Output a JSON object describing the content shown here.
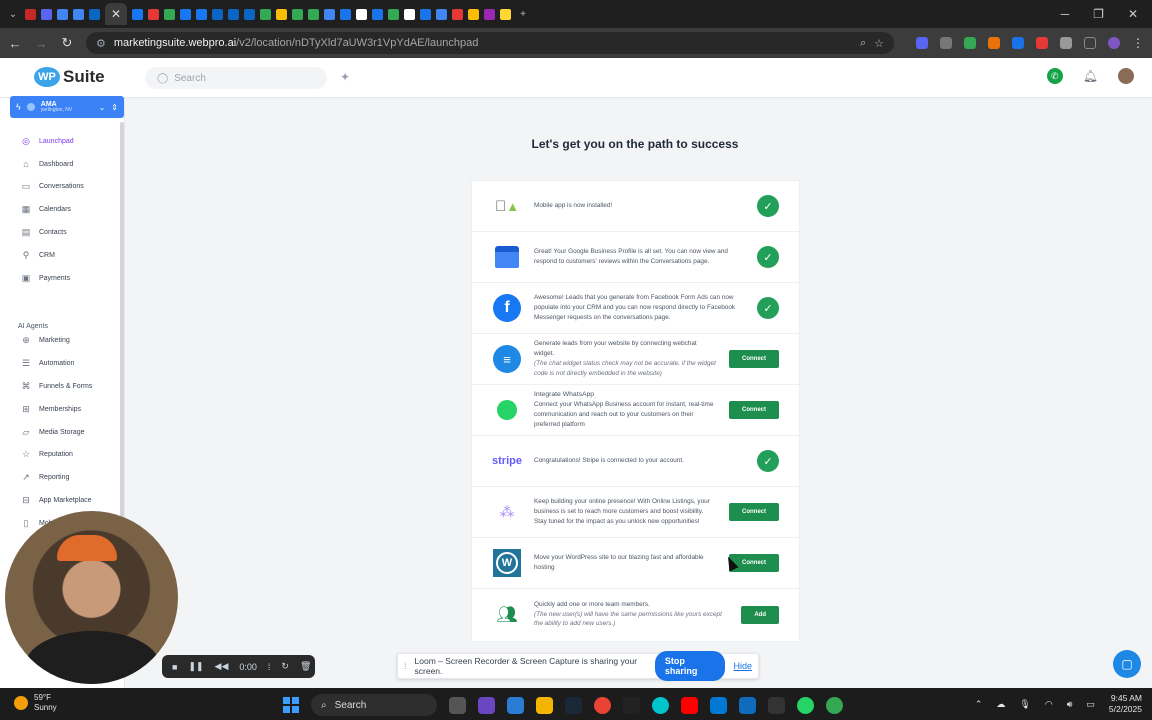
{
  "browser": {
    "url_host": "marketingsuite.webpro.ai",
    "url_path": "/v2/location/nDTyXld7aUW3r1VpYdAE/launchpad"
  },
  "header": {
    "logo_badge": "WP",
    "logo_text": "Suite",
    "search_placeholder": "Search"
  },
  "account": {
    "name": "AMA",
    "location": "yerlington, NV"
  },
  "sidebar": {
    "items": [
      {
        "label": "Launchpad",
        "icon": "rocket-icon",
        "active": true
      },
      {
        "label": "Dashboard",
        "icon": "home-icon"
      },
      {
        "label": "Conversations",
        "icon": "chat-icon"
      },
      {
        "label": "Calendars",
        "icon": "calendar-icon"
      },
      {
        "label": "Contacts",
        "icon": "contacts-icon"
      },
      {
        "label": "CRM",
        "icon": "filter-icon"
      },
      {
        "label": "Payments",
        "icon": "payments-icon"
      }
    ],
    "section_title": "AI Agents",
    "items2": [
      {
        "label": "Marketing",
        "icon": "globe-icon"
      },
      {
        "label": "Automation",
        "icon": "automation-icon"
      },
      {
        "label": "Funnels & Forms",
        "icon": "funnel-icon"
      },
      {
        "label": "Memberships",
        "icon": "membership-icon"
      },
      {
        "label": "Media Storage",
        "icon": "folder-icon"
      },
      {
        "label": "Reputation",
        "icon": "star-icon"
      },
      {
        "label": "Reporting",
        "icon": "chart-icon"
      },
      {
        "label": "App Marketplace",
        "icon": "grid-icon"
      },
      {
        "label": "Mobile A",
        "icon": "mobile-icon"
      }
    ]
  },
  "main": {
    "title": "Let's get you on the path to success",
    "rows": [
      {
        "icon": "apple-android-icon",
        "text": "Mobile app is now installed!",
        "status": "done"
      },
      {
        "icon": "google-business-icon",
        "text": "Great! Your Google Business Profile is all set. You can now view and respond to customers' reviews within the Conversations page.",
        "status": "done"
      },
      {
        "icon": "facebook-icon",
        "text": "Awesome! Leads that you generate from Facebook Form Ads can now populate into your CRM and you can now respond directly to Facebook Messenger requests on the conversations page.",
        "status": "done"
      },
      {
        "icon": "webchat-icon",
        "text": "Generate leads from your website by connecting webchat widget.",
        "note": "(The chat widget status check may not be accurate, if the widget code is not directly embedded in the website)",
        "action": "Connect"
      },
      {
        "icon": "whatsapp-icon",
        "heading": "Integrate WhatsApp",
        "text": "Connect your WhatsApp Business account for instant, real-time communication and reach out to your customers on their preferred platform",
        "action": "Connect"
      },
      {
        "icon": "stripe-icon",
        "icon_text": "stripe",
        "text": "Congratulations! Stripe is connected to your account.",
        "status": "done"
      },
      {
        "icon": "listings-icon",
        "text": "Keep building your online presence! With Online Listings, your business is set to reach more customers and boost visibility. Stay tuned for the impact as you unlock new opportunities!",
        "action": "Connect"
      },
      {
        "icon": "wordpress-icon",
        "text": "Move your WordPress site to our blazing fast and affordable hosting",
        "action": "Connect"
      },
      {
        "icon": "team-add-icon",
        "text": "Quickly add one or more team members.",
        "note": "(The new user(s) will have the same permissions like yours except the ability to add new users.)",
        "action": "Add"
      }
    ]
  },
  "recorder": {
    "time": "0:00"
  },
  "share_bar": {
    "message": "Loom – Screen Recorder & Screen Capture is sharing your screen.",
    "stop": "Stop sharing",
    "hide": "Hide"
  },
  "taskbar": {
    "temp": "59°F",
    "condition": "Sunny",
    "search": "Search",
    "time": "9:45 AM",
    "date": "5/2/2025"
  },
  "colors": {
    "accent": "#7c3aed",
    "brand_blue": "#3b82f6",
    "success": "#22a05a",
    "button_green": "#1e8e4e"
  }
}
